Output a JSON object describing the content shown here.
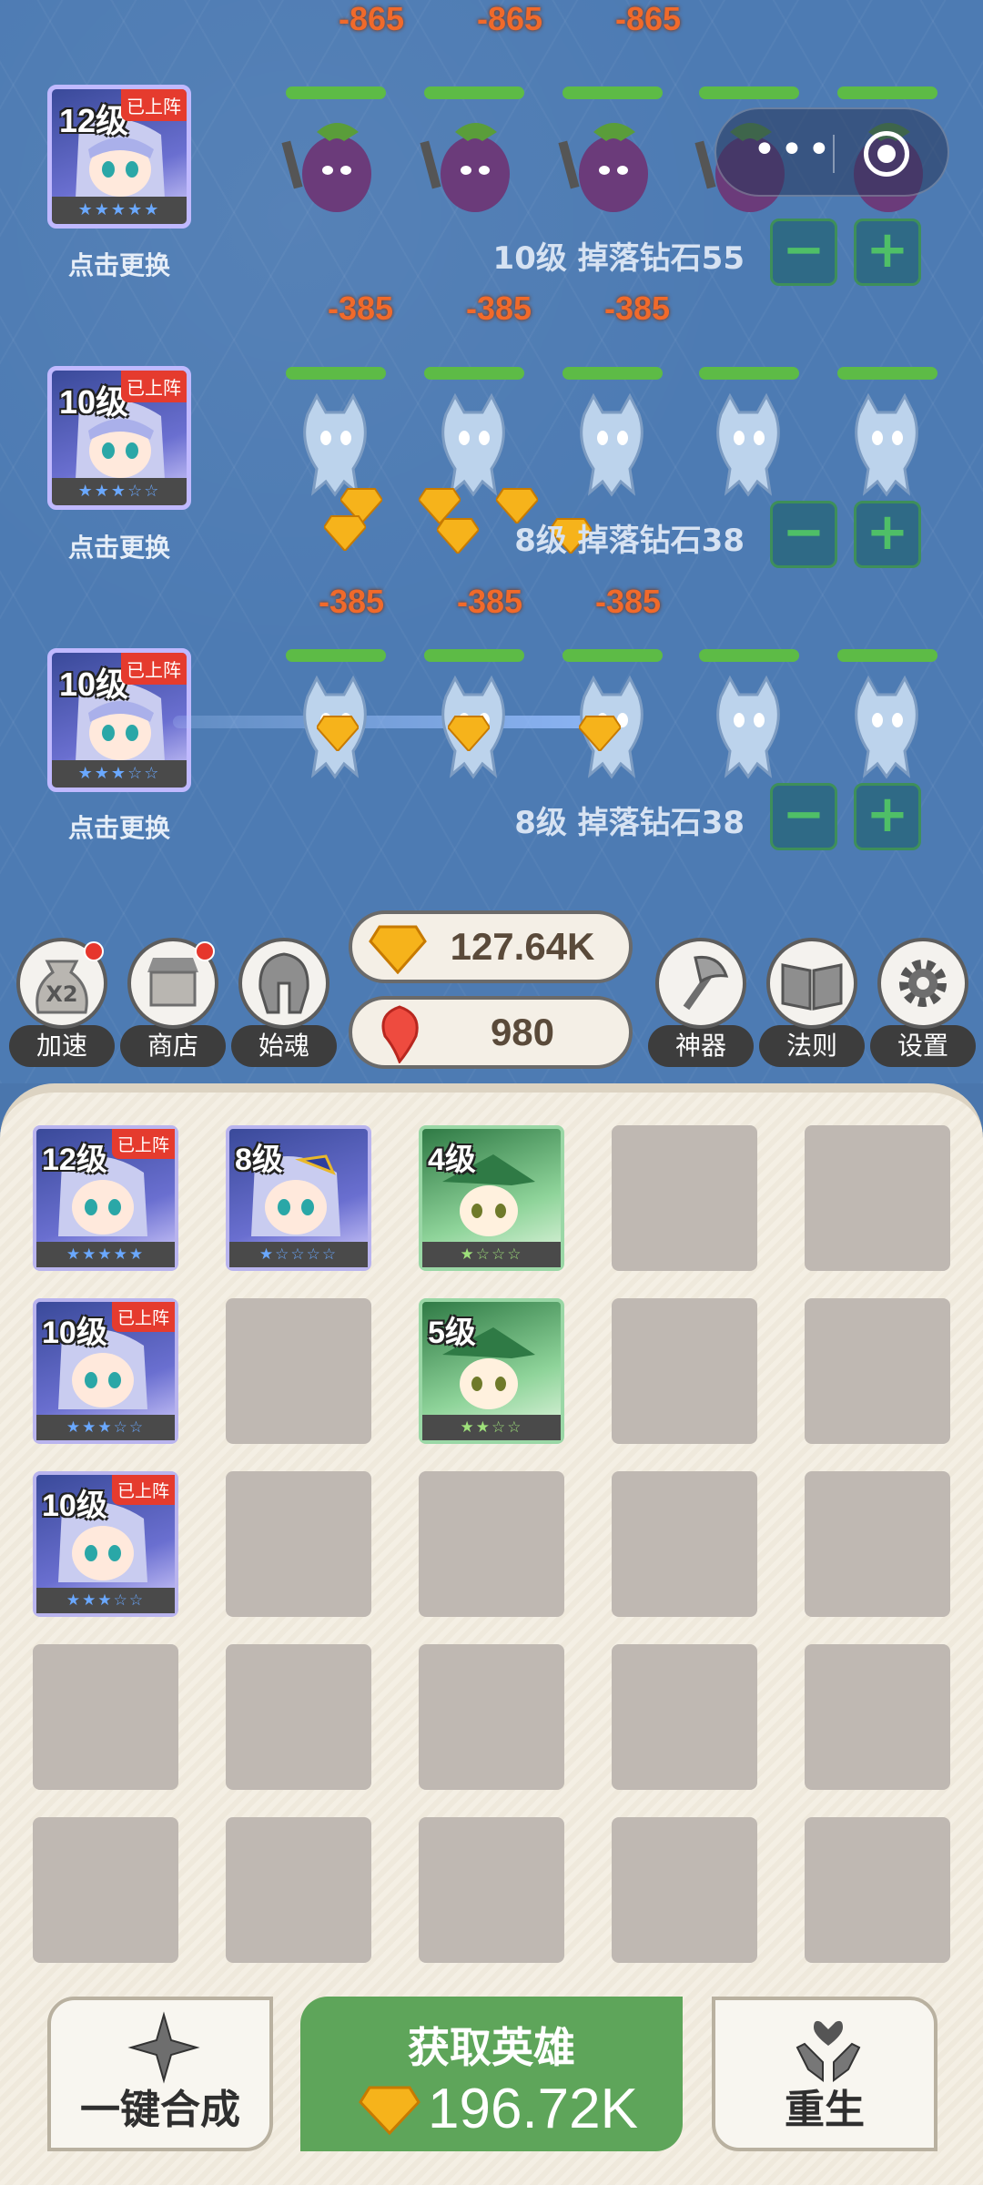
{
  "lanes": [
    {
      "hero_level": "12级",
      "hero_status": "已上阵",
      "hero_stars": "★★★★★",
      "swap_label": "点击更换",
      "damage": [
        "-865",
        "-865",
        "-865"
      ],
      "enemy_type": "eggplant",
      "drop_text": "10级 掉落钻石55"
    },
    {
      "hero_level": "10级",
      "hero_status": "已上阵",
      "hero_stars": "★★★☆☆",
      "swap_label": "点击更换",
      "damage": [
        "-385",
        "-385",
        "-385"
      ],
      "enemy_type": "ghost",
      "drop_text": "8级 掉落钻石38"
    },
    {
      "hero_level": "10级",
      "hero_status": "已上阵",
      "hero_stars": "★★★☆☆",
      "swap_label": "点击更换",
      "damage": [
        "-385",
        "-385",
        "-385"
      ],
      "enemy_type": "ghost",
      "drop_text": "8级 掉落钻石38"
    }
  ],
  "controls": {
    "minus": "−",
    "plus": "+"
  },
  "capsule": {
    "more": "•••"
  },
  "toolbar": {
    "speed": {
      "label": "加速",
      "badge": "X2"
    },
    "shop": {
      "label": "商店"
    },
    "soul": {
      "label": "始魂"
    },
    "artifact": {
      "label": "神器"
    },
    "rules": {
      "label": "法则"
    },
    "settings": {
      "label": "设置"
    }
  },
  "resources": {
    "diamonds": "127.64K",
    "essence": "980"
  },
  "inventory": [
    {
      "level": "12级",
      "status": "已上阵",
      "stars": "★★★★★",
      "type": "hero"
    },
    {
      "level": "8级",
      "status": "",
      "stars": "★☆☆☆☆",
      "type": "hero"
    },
    {
      "level": "4级",
      "status": "",
      "stars": "★☆☆☆",
      "type": "green"
    },
    {
      "level": "10级",
      "status": "已上阵",
      "stars": "★★★☆☆",
      "type": "hero"
    },
    {
      "level": "5级",
      "status": "",
      "stars": "★★☆☆",
      "type": "green"
    },
    {
      "level": "10级",
      "status": "已上阵",
      "stars": "★★★☆☆",
      "type": "hero"
    }
  ],
  "bottom": {
    "merge_label": "一键合成",
    "get_hero_label": "获取英雄",
    "get_hero_cost": "196.72K",
    "rebirth_label": "重生"
  },
  "colors": {
    "field": "#4d7bb3",
    "hp": "#5dbb46",
    "damage": "#f06a2b",
    "main_button": "#5ea55a"
  }
}
